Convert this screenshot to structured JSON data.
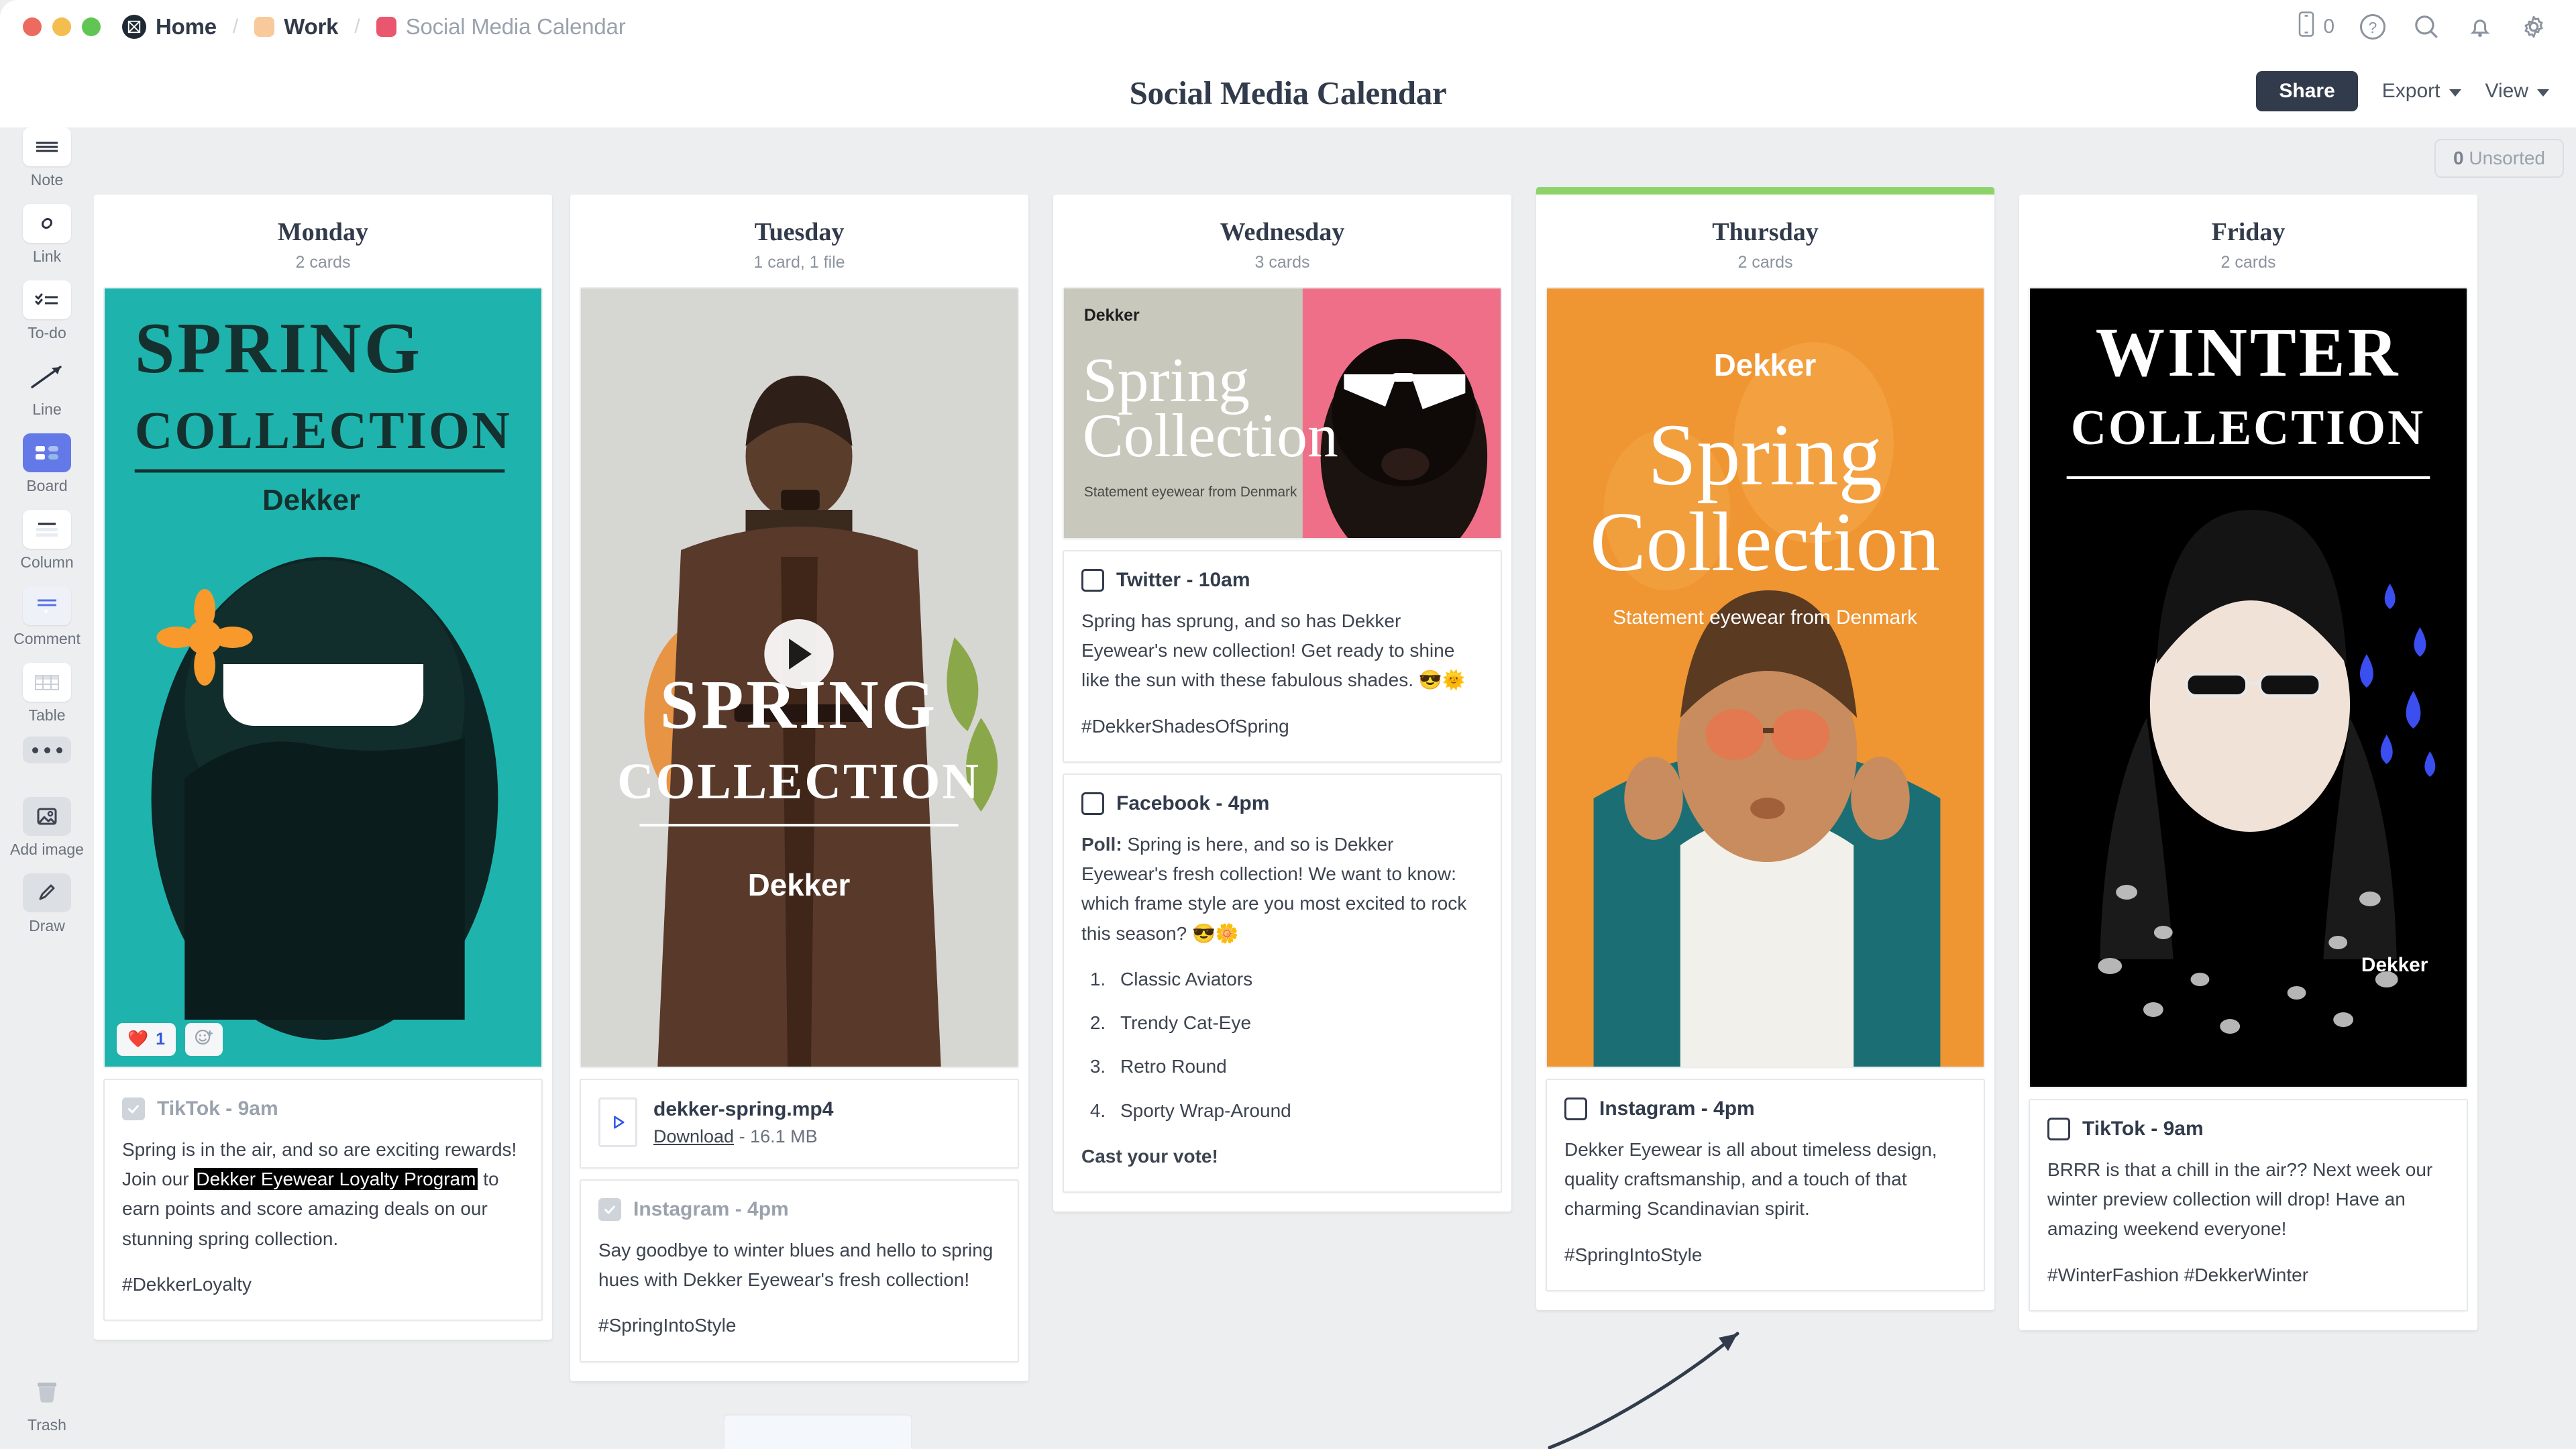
{
  "window": {
    "breadcrumbs": [
      {
        "label": "Home",
        "icon": "miro-logo-icon"
      },
      {
        "label": "Work",
        "icon": "folder-peach-icon"
      },
      {
        "label": "Social Media Calendar",
        "icon": "board-pink-icon"
      }
    ],
    "device_count": "0",
    "icons": [
      "device-icon",
      "help-icon",
      "search-icon",
      "bell-icon",
      "gear-icon"
    ]
  },
  "header": {
    "title": "Social Media Calendar",
    "share_label": "Share",
    "export_label": "Export",
    "view_label": "View"
  },
  "sidebar": {
    "items": [
      {
        "label": "Note",
        "icon": "note-icon",
        "active": false
      },
      {
        "label": "Link",
        "icon": "link-icon",
        "active": false
      },
      {
        "label": "To-do",
        "icon": "todo-icon",
        "active": false
      },
      {
        "label": "Line",
        "icon": "line-arrow-icon",
        "active": false
      },
      {
        "label": "Board",
        "icon": "board-icon",
        "active": true
      },
      {
        "label": "Column",
        "icon": "column-icon",
        "active": false
      },
      {
        "label": "Comment",
        "icon": "comment-icon",
        "active": false
      },
      {
        "label": "Table",
        "icon": "table-icon",
        "active": false
      }
    ],
    "more_label": "more-options",
    "extras": [
      {
        "label": "Add image",
        "icon": "image-icon"
      },
      {
        "label": "Draw",
        "icon": "pencil-icon"
      }
    ],
    "trash_label": "Trash"
  },
  "board": {
    "unsorted_count": "0",
    "unsorted_label": "Unsorted",
    "columns": [
      {
        "title": "Monday",
        "count": "2 cards",
        "accent": null,
        "poster": {
          "kind": "spring-teal",
          "brand": "Dekker",
          "line1": "SPRING",
          "line2": "COLLECTION",
          "bg": "#1fb3ad"
        },
        "reactions": [
          {
            "emoji": "heart",
            "count": "1"
          },
          {
            "emoji": "add-reaction"
          }
        ],
        "cards": [
          {
            "platform": "TikTok - 9am",
            "checked": true,
            "body_pre": "Spring is in the air, and so are exciting rewards! Join our ",
            "highlight": "Dekker Eyewear Loyalty Program",
            "body_post": " to earn points and score amazing deals on our stunning spring collection.",
            "hashtags": "#DekkerLoyalty"
          }
        ]
      },
      {
        "title": "Tuesday",
        "count": "1 card, 1 file",
        "accent": null,
        "poster": {
          "kind": "spring-grey-video",
          "brand": "Dekker",
          "line1": "SPRING",
          "line2": "COLLECTION",
          "bg": "#d4d4d2"
        },
        "file": {
          "name": "dekker-spring.mp4",
          "download_label": "Download",
          "size": "16.1 MB"
        },
        "cards": [
          {
            "platform": "Instagram - 4pm",
            "checked": true,
            "body": "Say goodbye to winter blues and hello to spring hues with Dekker Eyewear's fresh collection!",
            "hashtags": "#SpringIntoStyle"
          }
        ]
      },
      {
        "title": "Wednesday",
        "count": "3 cards",
        "accent": null,
        "poster": {
          "kind": "spring-split-pink",
          "brand": "Dekker",
          "line1": "Spring",
          "line2": "Collection",
          "tagline": "Statement eyewear from Denmark",
          "bg": "#c8c8bd",
          "accent": "#ef6f88"
        },
        "cards": [
          {
            "platform": "Twitter - 10am",
            "checked": false,
            "body": "Spring has sprung, and so has Dekker Eyewear's new collection! Get ready to shine like the sun with these fabulous shades. 😎🌞",
            "hashtags": "#DekkerShadesOfSpring"
          },
          {
            "platform": "Facebook - 4pm",
            "checked": false,
            "poll_prefix": "Poll:",
            "body": " Spring is here, and so is Dekker Eyewear's fresh collection! We want to know: which frame style are you most excited to rock this season? 😎🌼",
            "options": [
              "Classic Aviators",
              "Trendy Cat-Eye",
              "Retro Round",
              "Sporty Wrap-Around"
            ],
            "cta": "Cast your vote!"
          }
        ]
      },
      {
        "title": "Thursday",
        "count": "2 cards",
        "accent": "#8ed36a",
        "poster": {
          "kind": "spring-orange",
          "brand": "Dekker",
          "line1": "Spring",
          "line2": "Collection",
          "tagline": "Statement eyewear from Denmark",
          "bg": "#ef9532"
        },
        "cards": [
          {
            "platform": "Instagram - 4pm",
            "checked": false,
            "body": "Dekker Eyewear is all about timeless design, quality craftsmanship, and a touch of that charming Scandinavian spirit.",
            "hashtags": "#SpringIntoStyle"
          }
        ]
      },
      {
        "title": "Friday",
        "count": "2 cards",
        "accent": null,
        "poster": {
          "kind": "winter-black",
          "brand": "Dekker",
          "line1": "WINTER",
          "line2": "COLLECTION",
          "bg": "#000000"
        },
        "cards": [
          {
            "platform": "TikTok - 9am",
            "checked": false,
            "body": "BRRR is that a chill in the air?? Next week our winter preview collection will drop! Have an amazing weekend everyone!",
            "hashtags": "#WinterFashion #DekkerWinter"
          }
        ]
      }
    ]
  }
}
